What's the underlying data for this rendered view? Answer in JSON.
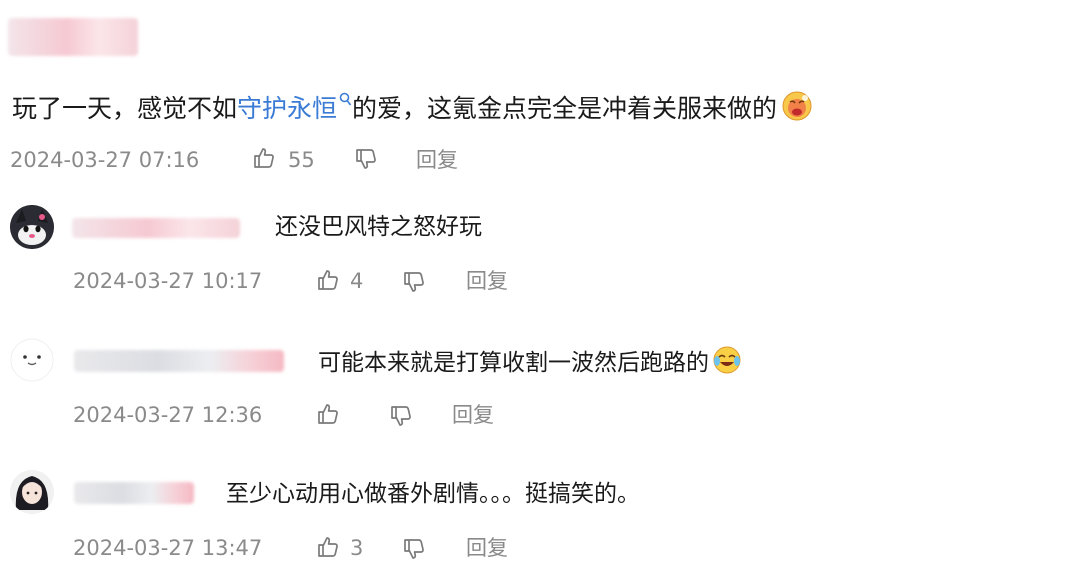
{
  "top_comment": {
    "text_before": "玩了一天，感觉不如",
    "link": "守护永恒",
    "text_after": "的爱，这氪金点完全是冲着关服来做的",
    "date": "2024-03-27 07:16",
    "likes": "55",
    "reply_label": "回复",
    "link_icon": "search-icon",
    "emoji": "crying-face-emoji"
  },
  "replies": [
    {
      "text": "还没巴风特之怒好玩",
      "date": "2024-03-27 10:17",
      "likes": "4",
      "reply_label": "回复"
    },
    {
      "text": "可能本来就是打算收割一波然后跑路的",
      "date": "2024-03-27 12:36",
      "likes": "",
      "reply_label": "回复",
      "emoji": "laughing-crying-emoji"
    },
    {
      "text": "至少心动用心做番外剧情。。。挺搞笑的。",
      "date": "2024-03-27 13:47",
      "likes": "3",
      "reply_label": "回复"
    }
  ]
}
